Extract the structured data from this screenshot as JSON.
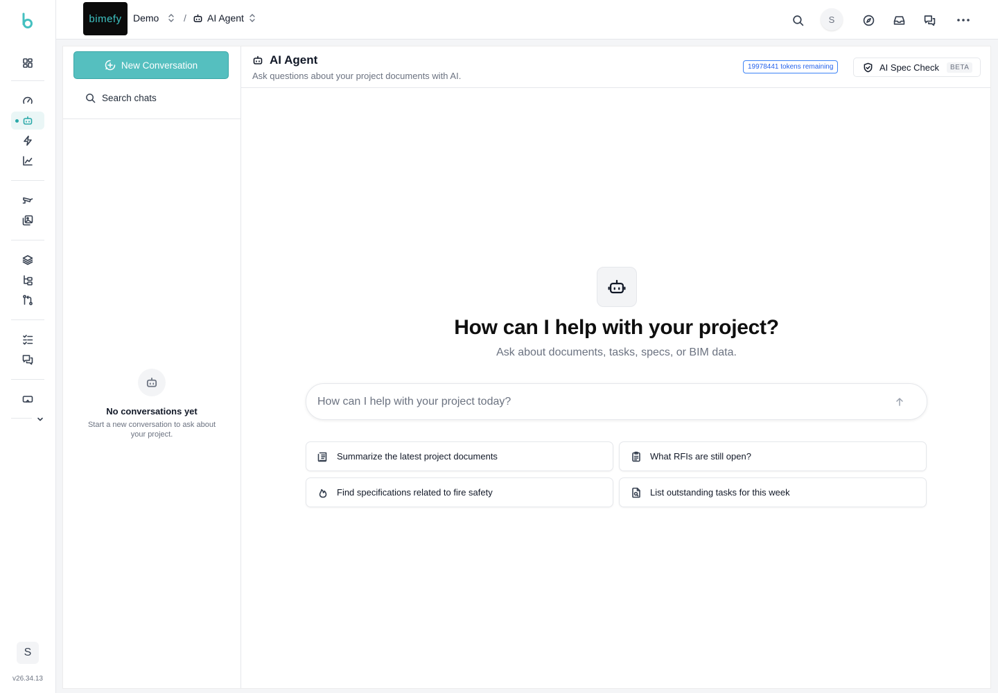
{
  "app": {
    "version": "v26.34.13",
    "user_initial": "S",
    "brand_text": "bimefy"
  },
  "breadcrumb": {
    "project": "Demo",
    "separator": "/",
    "page": "AI Agent"
  },
  "sidebar": {
    "new_conversation": "New Conversation",
    "search_label": "Search chats",
    "empty_title": "No conversations yet",
    "empty_subtitle": "Start a new conversation to ask about your project."
  },
  "header": {
    "title": "AI Agent",
    "subtitle": "Ask questions about your project documents with AI.",
    "tokens": "19978441 tokens remaining",
    "spec_check": "AI Spec Check",
    "beta": "BETA"
  },
  "hero": {
    "title": "How can I help with your project?",
    "subtitle": "Ask about documents, tasks, specs, or BIM data."
  },
  "prompt": {
    "placeholder": "How can I help with your project today?"
  },
  "suggestions": [
    {
      "label": "Summarize the latest project documents",
      "icon": "document-list-icon"
    },
    {
      "label": "What RFIs are still open?",
      "icon": "clipboard-icon"
    },
    {
      "label": "Find specifications related to fire safety",
      "icon": "flame-icon"
    },
    {
      "label": "List outstanding tasks for this week",
      "icon": "file-search-icon"
    }
  ],
  "colors": {
    "accent": "#55bfbf",
    "accent_dark": "#2aa9a9",
    "token_blue": "#2563eb"
  }
}
